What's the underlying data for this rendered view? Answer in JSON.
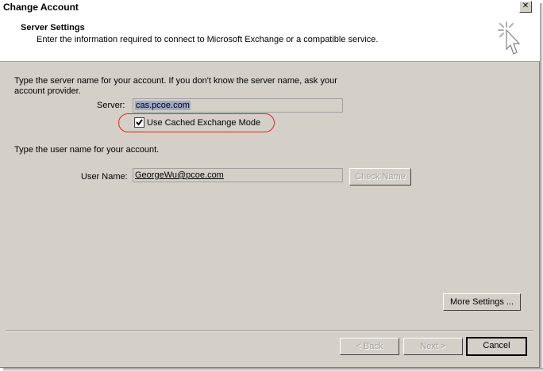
{
  "window": {
    "title": "Change Account",
    "close_label": "✕"
  },
  "header": {
    "title": "Server Settings",
    "description": "Enter the information required to connect to Microsoft Exchange or a compatible service.",
    "icon": "cursor-sparkle-icon"
  },
  "server_section": {
    "instruction_line1": "Type the server name for your account. If you don't know the server name, ask your",
    "instruction_line2": "account provider.",
    "server_label": "Server:",
    "server_value": "cas.pcoe.com",
    "cached_mode_label": "Use Cached Exchange Mode",
    "cached_mode_checked": true
  },
  "user_section": {
    "instruction": "Type the user name for your account.",
    "user_label": "User Name:",
    "user_value": "GeorgeWu@pcoe.com",
    "check_name_label": "Check Name"
  },
  "buttons": {
    "more_settings": "More Settings ...",
    "back": "< Back",
    "next": "Next >",
    "cancel": "Cancel"
  },
  "colors": {
    "dialog_bg": "#d4d0c8",
    "highlight_ellipse": "#e32222",
    "selection": "#9fa9c5"
  }
}
